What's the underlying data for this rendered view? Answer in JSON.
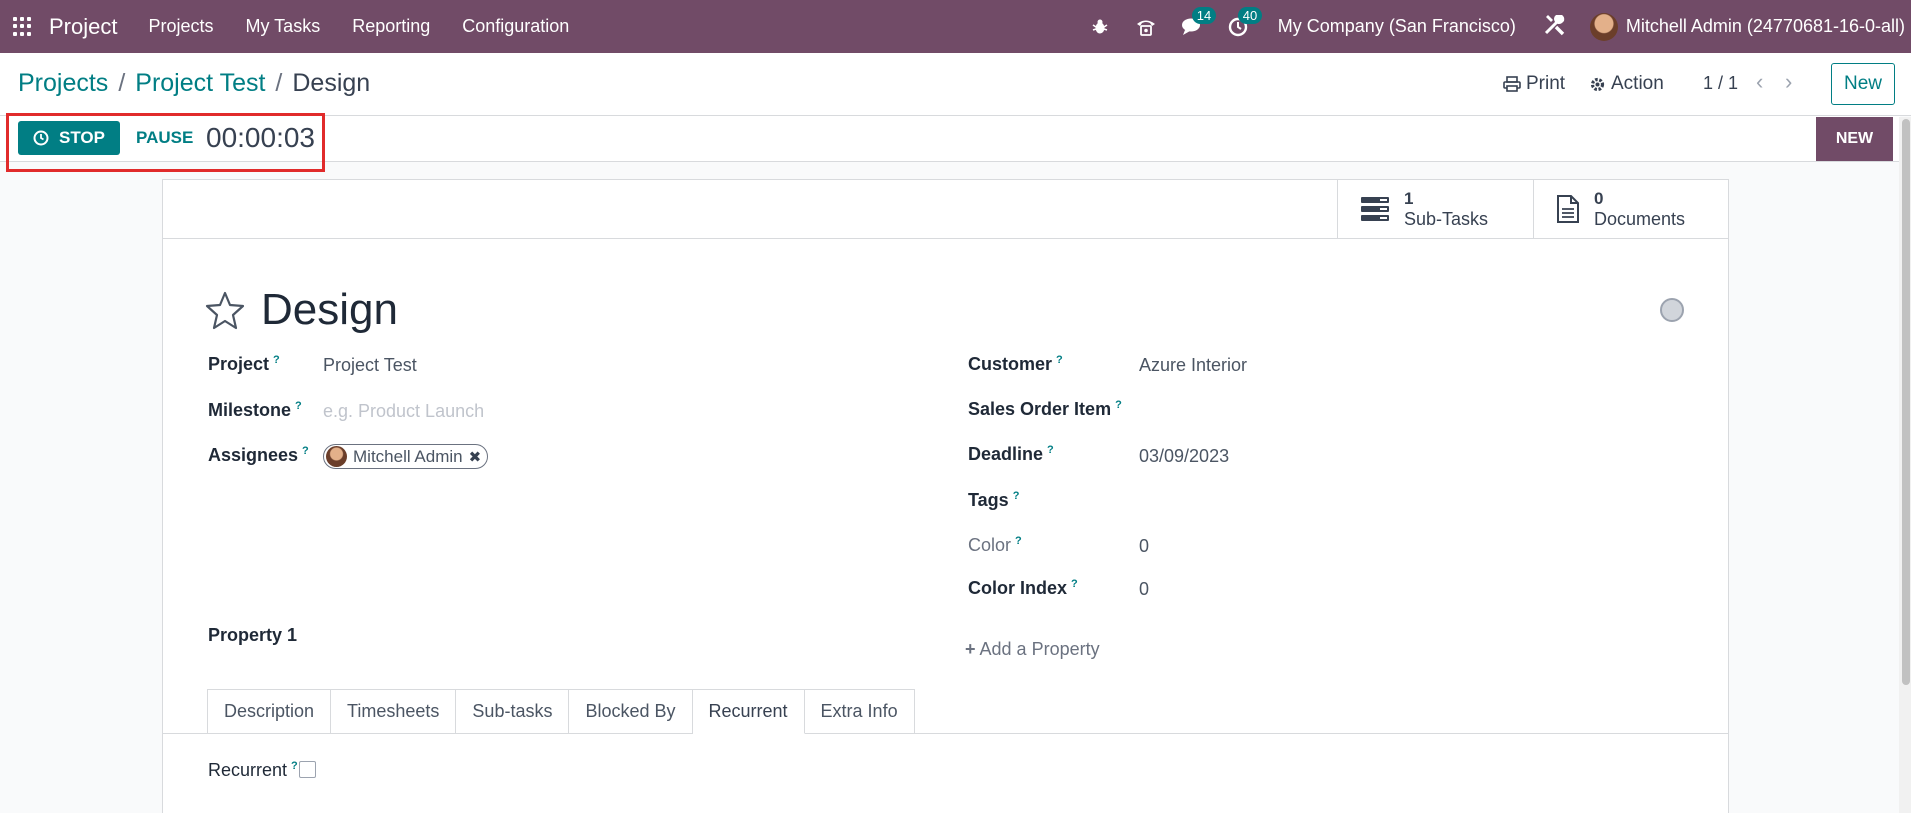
{
  "navbar": {
    "app_name": "Project",
    "menu": [
      "Projects",
      "My Tasks",
      "Reporting",
      "Configuration"
    ],
    "messages_count": "14",
    "activities_count": "40",
    "company": "My Company (San Francisco)",
    "user": "Mitchell Admin (24770681-16-0-all)",
    "icons": [
      "apps-grid-icon",
      "bug-icon",
      "phone-icon",
      "chat-icon",
      "clock-icon",
      "tools-icon"
    ]
  },
  "breadcrumb": [
    "Projects",
    "Project Test",
    "Design"
  ],
  "control": {
    "print_label": "Print",
    "action_label": "Action",
    "pager": "1 / 1",
    "new_label": "New"
  },
  "timer": {
    "stop_label": "STOP",
    "pause_label": "PAUSE",
    "value": "00:00:03",
    "stage": "NEW"
  },
  "smart_buttons": {
    "subtasks": {
      "count": "1",
      "label": "Sub-Tasks"
    },
    "documents": {
      "count": "0",
      "label": "Documents"
    }
  },
  "form": {
    "title": "Design",
    "left": {
      "project_label": "Project",
      "project_value": "Project Test",
      "milestone_label": "Milestone",
      "milestone_placeholder": "e.g. Product Launch",
      "assignees_label": "Assignees",
      "assignee": "Mitchell Admin",
      "property_label": "Property 1"
    },
    "right": {
      "customer_label": "Customer",
      "customer_value": "Azure Interior",
      "so_item_label": "Sales Order Item",
      "deadline_label": "Deadline",
      "deadline_value": "03/09/2023",
      "tags_label": "Tags",
      "color_label": "Color",
      "color_value": "0",
      "color_index_label": "Color Index",
      "color_index_value": "0",
      "add_property": "Add a Property"
    },
    "tabs": [
      "Description",
      "Timesheets",
      "Sub-tasks",
      "Blocked By",
      "Recurrent",
      "Extra Info"
    ],
    "active_tab": "Recurrent",
    "recurrent_label": "Recurrent",
    "help_mark": "?"
  },
  "colors": {
    "brand": "#714b67",
    "accent": "#017e84",
    "highlight_box": "#e12b2b"
  }
}
